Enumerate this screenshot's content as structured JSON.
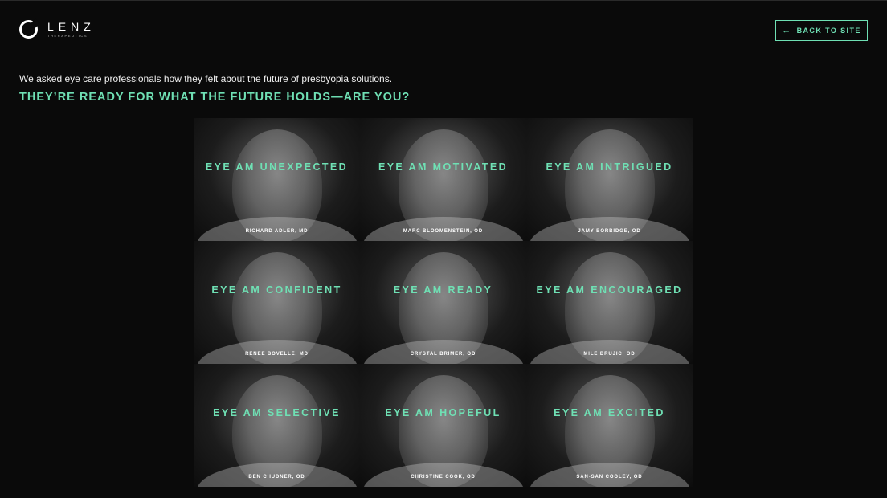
{
  "header": {
    "brand": "LENZ",
    "brand_sub": "THERAPEUTICS",
    "back_label": "BACK TO SITE",
    "back_icon": "arrow-left-icon"
  },
  "intro": {
    "text": "We asked eye care professionals how they felt about the future of presbyopia solutions.",
    "headline": "THEY’RE READY FOR WHAT THE FUTURE HOLDS—ARE YOU?"
  },
  "tiles": [
    {
      "title": "EYE AM UNEXPECTED",
      "name": "RICHARD ADLER, MD"
    },
    {
      "title": "EYE AM MOTIVATED",
      "name": "MARC BLOOMENSTEIN, OD"
    },
    {
      "title": "EYE AM INTRIGUED",
      "name": "JAMY BORBIDGE, OD"
    },
    {
      "title": "EYE AM CONFIDENT",
      "name": "RENEE BOVELLE, MD"
    },
    {
      "title": "EYE AM READY",
      "name": "CRYSTAL BRIMER, OD"
    },
    {
      "title": "EYE AM ENCOURAGED",
      "name": "MILE BRUJIC, OD"
    },
    {
      "title": "EYE AM SELECTIVE",
      "name": "BEN CHUDNER, OD"
    },
    {
      "title": "EYE AM HOPEFUL",
      "name": "CHRISTINE COOK, OD"
    },
    {
      "title": "EYE AM EXCITED",
      "name": "SAN-SAN COOLEY, OD"
    }
  ],
  "colors": {
    "accent": "#6fe0b4",
    "background": "#0a0a0a"
  }
}
